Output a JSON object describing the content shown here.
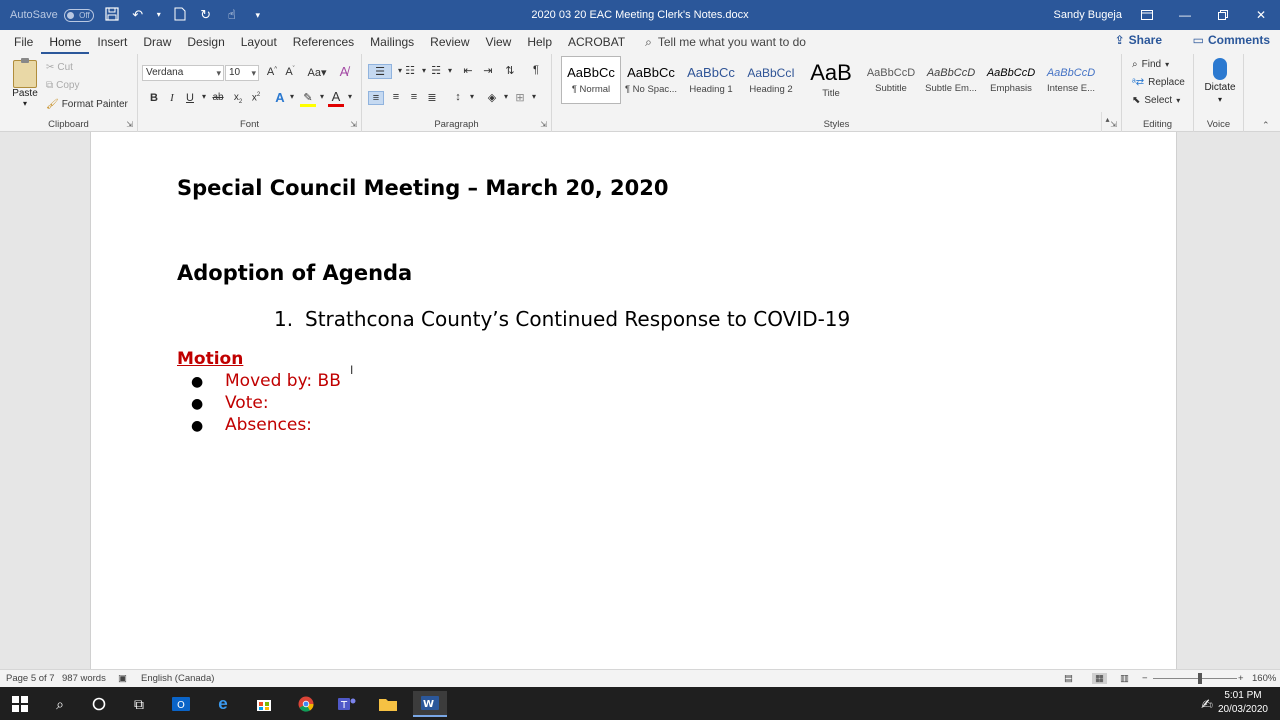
{
  "titlebar": {
    "autosave_label": "AutoSave",
    "autosave_state": "Off",
    "doc_title": "2020 03 20 EAC Meeting Clerk's Notes.docx",
    "user": "Sandy Bugeja"
  },
  "tabs": [
    "File",
    "Home",
    "Insert",
    "Draw",
    "Design",
    "Layout",
    "References",
    "Mailings",
    "Review",
    "View",
    "Help",
    "ACROBAT"
  ],
  "active_tab": "Home",
  "tellme": "Tell me what you want to do",
  "share": "Share",
  "comments": "Comments",
  "clipboard": {
    "paste": "Paste",
    "cut": "Cut",
    "copy": "Copy",
    "format_painter": "Format Painter",
    "label": "Clipboard"
  },
  "font": {
    "name": "Verdana",
    "size": "10",
    "label": "Font"
  },
  "paragraph": {
    "label": "Paragraph"
  },
  "styles": {
    "label": "Styles",
    "items": [
      {
        "sample": "AaBbCc",
        "name": "¶ Normal"
      },
      {
        "sample": "AaBbCc",
        "name": "¶ No Spac..."
      },
      {
        "sample": "AaBbCc",
        "name": "Heading 1"
      },
      {
        "sample": "AaBbCcI",
        "name": "Heading 2"
      },
      {
        "sample": "AaB",
        "name": "Title"
      },
      {
        "sample": "AaBbCcD",
        "name": "Subtitle"
      },
      {
        "sample": "AaBbCcD",
        "name": "Subtle Em..."
      },
      {
        "sample": "AaBbCcD",
        "name": "Emphasis"
      },
      {
        "sample": "AaBbCcD",
        "name": "Intense E..."
      }
    ]
  },
  "editing": {
    "find": "Find",
    "replace": "Replace",
    "select": "Select",
    "label": "Editing"
  },
  "voice": {
    "dictate": "Dictate",
    "label": "Voice"
  },
  "document": {
    "heading": "Special Council Meeting – March 20, 2020",
    "agenda_heading": "Adoption of Agenda",
    "agenda_item_number": "1.",
    "agenda_item_text": "Strathcona County’s Continued Response to COVID-19",
    "motion": "Motion",
    "bullets": [
      "Moved by: BB",
      "Vote:",
      "Absences:"
    ]
  },
  "status": {
    "page": "Page 5 of 7",
    "words": "987 words",
    "language": "English (Canada)",
    "zoom": "160%"
  },
  "clock": {
    "time": "5:01 PM",
    "date": "20/03/2020"
  },
  "colors": {
    "word_blue": "#2b579a",
    "motion_red": "#c00000"
  }
}
